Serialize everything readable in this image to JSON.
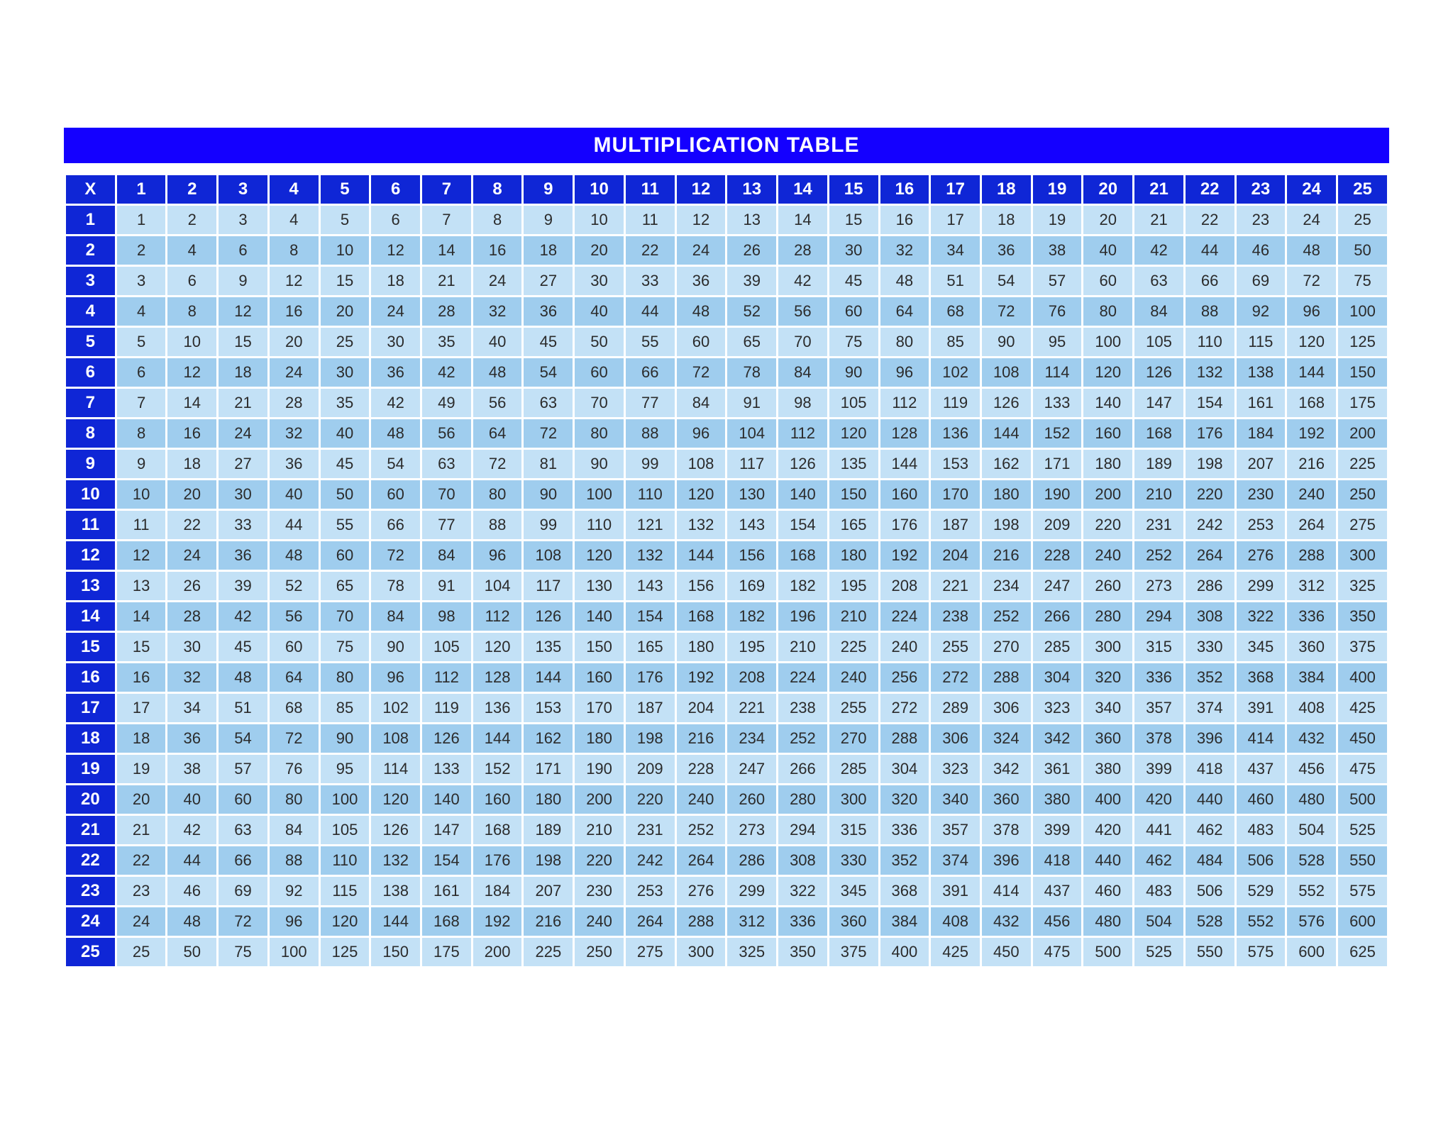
{
  "chart_data": {
    "type": "table",
    "title": "MULTIPLICATION TABLE",
    "corner_label": "X",
    "size": 25,
    "col_headers": [
      1,
      2,
      3,
      4,
      5,
      6,
      7,
      8,
      9,
      10,
      11,
      12,
      13,
      14,
      15,
      16,
      17,
      18,
      19,
      20,
      21,
      22,
      23,
      24,
      25
    ],
    "row_headers": [
      1,
      2,
      3,
      4,
      5,
      6,
      7,
      8,
      9,
      10,
      11,
      12,
      13,
      14,
      15,
      16,
      17,
      18,
      19,
      20,
      21,
      22,
      23,
      24,
      25
    ],
    "values": [
      [
        1,
        2,
        3,
        4,
        5,
        6,
        7,
        8,
        9,
        10,
        11,
        12,
        13,
        14,
        15,
        16,
        17,
        18,
        19,
        20,
        21,
        22,
        23,
        24,
        25
      ],
      [
        2,
        4,
        6,
        8,
        10,
        12,
        14,
        16,
        18,
        20,
        22,
        24,
        26,
        28,
        30,
        32,
        34,
        36,
        38,
        40,
        42,
        44,
        46,
        48,
        50
      ],
      [
        3,
        6,
        9,
        12,
        15,
        18,
        21,
        24,
        27,
        30,
        33,
        36,
        39,
        42,
        45,
        48,
        51,
        54,
        57,
        60,
        63,
        66,
        69,
        72,
        75
      ],
      [
        4,
        8,
        12,
        16,
        20,
        24,
        28,
        32,
        36,
        40,
        44,
        48,
        52,
        56,
        60,
        64,
        68,
        72,
        76,
        80,
        84,
        88,
        92,
        96,
        100
      ],
      [
        5,
        10,
        15,
        20,
        25,
        30,
        35,
        40,
        45,
        50,
        55,
        60,
        65,
        70,
        75,
        80,
        85,
        90,
        95,
        100,
        105,
        110,
        115,
        120,
        125
      ],
      [
        6,
        12,
        18,
        24,
        30,
        36,
        42,
        48,
        54,
        60,
        66,
        72,
        78,
        84,
        90,
        96,
        102,
        108,
        114,
        120,
        126,
        132,
        138,
        144,
        150
      ],
      [
        7,
        14,
        21,
        28,
        35,
        42,
        49,
        56,
        63,
        70,
        77,
        84,
        91,
        98,
        105,
        112,
        119,
        126,
        133,
        140,
        147,
        154,
        161,
        168,
        175
      ],
      [
        8,
        16,
        24,
        32,
        40,
        48,
        56,
        64,
        72,
        80,
        88,
        96,
        104,
        112,
        120,
        128,
        136,
        144,
        152,
        160,
        168,
        176,
        184,
        192,
        200
      ],
      [
        9,
        18,
        27,
        36,
        45,
        54,
        63,
        72,
        81,
        90,
        99,
        108,
        117,
        126,
        135,
        144,
        153,
        162,
        171,
        180,
        189,
        198,
        207,
        216,
        225
      ],
      [
        10,
        20,
        30,
        40,
        50,
        60,
        70,
        80,
        90,
        100,
        110,
        120,
        130,
        140,
        150,
        160,
        170,
        180,
        190,
        200,
        210,
        220,
        230,
        240,
        250
      ],
      [
        11,
        22,
        33,
        44,
        55,
        66,
        77,
        88,
        99,
        110,
        121,
        132,
        143,
        154,
        165,
        176,
        187,
        198,
        209,
        220,
        231,
        242,
        253,
        264,
        275
      ],
      [
        12,
        24,
        36,
        48,
        60,
        72,
        84,
        96,
        108,
        120,
        132,
        144,
        156,
        168,
        180,
        192,
        204,
        216,
        228,
        240,
        252,
        264,
        276,
        288,
        300
      ],
      [
        13,
        26,
        39,
        52,
        65,
        78,
        91,
        104,
        117,
        130,
        143,
        156,
        169,
        182,
        195,
        208,
        221,
        234,
        247,
        260,
        273,
        286,
        299,
        312,
        325
      ],
      [
        14,
        28,
        42,
        56,
        70,
        84,
        98,
        112,
        126,
        140,
        154,
        168,
        182,
        196,
        210,
        224,
        238,
        252,
        266,
        280,
        294,
        308,
        322,
        336,
        350
      ],
      [
        15,
        30,
        45,
        60,
        75,
        90,
        105,
        120,
        135,
        150,
        165,
        180,
        195,
        210,
        225,
        240,
        255,
        270,
        285,
        300,
        315,
        330,
        345,
        360,
        375
      ],
      [
        16,
        32,
        48,
        64,
        80,
        96,
        112,
        128,
        144,
        160,
        176,
        192,
        208,
        224,
        240,
        256,
        272,
        288,
        304,
        320,
        336,
        352,
        368,
        384,
        400
      ],
      [
        17,
        34,
        51,
        68,
        85,
        102,
        119,
        136,
        153,
        170,
        187,
        204,
        221,
        238,
        255,
        272,
        289,
        306,
        323,
        340,
        357,
        374,
        391,
        408,
        425
      ],
      [
        18,
        36,
        54,
        72,
        90,
        108,
        126,
        144,
        162,
        180,
        198,
        216,
        234,
        252,
        270,
        288,
        306,
        324,
        342,
        360,
        378,
        396,
        414,
        432,
        450
      ],
      [
        19,
        38,
        57,
        76,
        95,
        114,
        133,
        152,
        171,
        190,
        209,
        228,
        247,
        266,
        285,
        304,
        323,
        342,
        361,
        380,
        399,
        418,
        437,
        456,
        475
      ],
      [
        20,
        40,
        60,
        80,
        100,
        120,
        140,
        160,
        180,
        200,
        220,
        240,
        260,
        280,
        300,
        320,
        340,
        360,
        380,
        400,
        420,
        440,
        460,
        480,
        500
      ],
      [
        21,
        42,
        63,
        84,
        105,
        126,
        147,
        168,
        189,
        210,
        231,
        252,
        273,
        294,
        315,
        336,
        357,
        378,
        399,
        420,
        441,
        462,
        483,
        504,
        525
      ],
      [
        22,
        44,
        66,
        88,
        110,
        132,
        154,
        176,
        198,
        220,
        242,
        264,
        286,
        308,
        330,
        352,
        374,
        396,
        418,
        440,
        462,
        484,
        506,
        528,
        550
      ],
      [
        23,
        46,
        69,
        92,
        115,
        138,
        161,
        184,
        207,
        230,
        253,
        276,
        299,
        322,
        345,
        368,
        391,
        414,
        437,
        460,
        483,
        506,
        529,
        552,
        575
      ],
      [
        24,
        48,
        72,
        96,
        120,
        144,
        168,
        192,
        216,
        240,
        264,
        288,
        312,
        336,
        360,
        384,
        408,
        432,
        456,
        480,
        504,
        528,
        552,
        576,
        600
      ],
      [
        25,
        50,
        75,
        100,
        125,
        150,
        175,
        200,
        225,
        250,
        275,
        300,
        325,
        350,
        375,
        400,
        425,
        450,
        475,
        500,
        525,
        550,
        575,
        600,
        625
      ]
    ]
  }
}
